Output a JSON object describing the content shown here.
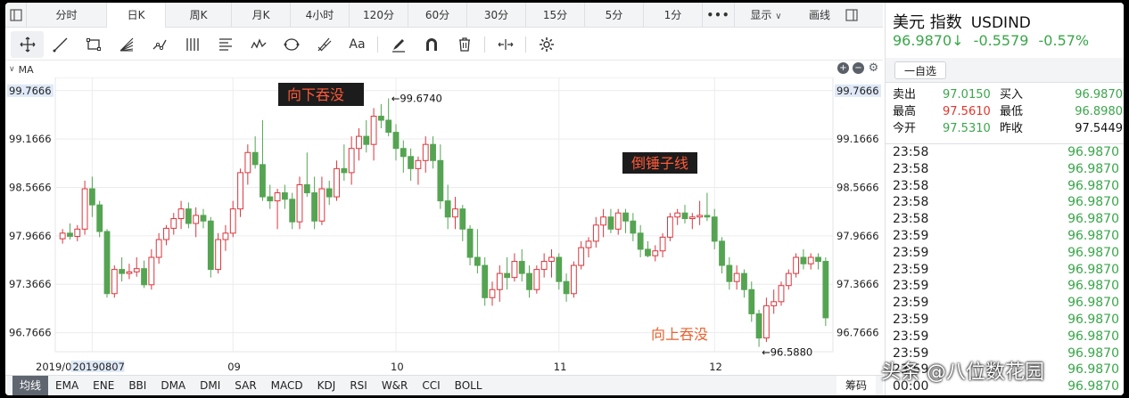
{
  "period_tabs": [
    {
      "label": "分时",
      "w": 90,
      "active": false
    },
    {
      "label": "日K",
      "w": 66,
      "active": true
    },
    {
      "label": "周K",
      "w": 74,
      "active": false
    },
    {
      "label": "月K",
      "w": 66,
      "active": false
    },
    {
      "label": "4小时",
      "w": 66,
      "active": false
    },
    {
      "label": "120分",
      "w": 66,
      "active": false
    },
    {
      "label": "60分",
      "w": 66,
      "active": false
    },
    {
      "label": "30分",
      "w": 66,
      "active": false
    },
    {
      "label": "15分",
      "w": 66,
      "active": false
    },
    {
      "label": "5分",
      "w": 66,
      "active": false
    },
    {
      "label": "1分",
      "w": 66,
      "active": false
    },
    {
      "label": "•••",
      "w": 36,
      "active": false,
      "cls": "more"
    }
  ],
  "display_menu": "显示",
  "draw_menu": "画线",
  "toolbar": {
    "font_tool_label": "Aa",
    "tools": [
      "crosshair-tool",
      "trendline-tool",
      "rectangle-tool",
      "fan-tool",
      "path-tool",
      "parallel-tool",
      "fib-tool",
      "wave-tool",
      "ellipse-tool",
      "gann-tool",
      "text-tool",
      "brush-tool",
      "magnet-tool",
      "delete-tool",
      "measure-tool",
      "settings-tool"
    ]
  },
  "ma_label": "MA",
  "chart": {
    "y_labels": [
      "99.7666",
      "99.1666",
      "98.5666",
      "97.9666",
      "97.3666",
      "96.7666"
    ],
    "y_values": [
      99.7666,
      99.1666,
      98.5666,
      97.9666,
      97.3666,
      96.7666
    ],
    "y_range": [
      96.53,
      99.93
    ],
    "x_labels": [
      {
        "text": "2019/07",
        "index": 0
      },
      {
        "text": "20190807",
        "index": 4,
        "highlight": true
      },
      {
        "text": "09",
        "index": 23
      },
      {
        "text": "10",
        "index": 45
      },
      {
        "text": "11",
        "index": 67
      },
      {
        "text": "12",
        "index": 88
      }
    ],
    "up_color": "#d9363e",
    "down_color": "#54a452",
    "high_label": "←99.6740",
    "low_label": "←96.5880",
    "annotations": [
      {
        "text": "向下吞没",
        "style": "dark",
        "color": "#ff5a3a"
      },
      {
        "text": "倒锤子线",
        "style": "dark",
        "color": "#ff5a3a"
      },
      {
        "text": "向上吞没",
        "style": "plain",
        "color": "#e8622f"
      }
    ]
  },
  "chart_data": {
    "type": "candlestick",
    "ohlc": [
      [
        97.93,
        98.05,
        97.87,
        98.0
      ],
      [
        98.0,
        98.12,
        97.92,
        97.96
      ],
      [
        97.96,
        98.1,
        97.9,
        98.05
      ],
      [
        98.05,
        98.65,
        97.98,
        98.55
      ],
      [
        98.55,
        98.7,
        98.2,
        98.35
      ],
      [
        98.35,
        98.4,
        97.95,
        98.02
      ],
      [
        98.02,
        98.05,
        97.2,
        97.25
      ],
      [
        97.25,
        97.6,
        97.2,
        97.55
      ],
      [
        97.55,
        97.7,
        97.4,
        97.5
      ],
      [
        97.5,
        97.62,
        97.43,
        97.52
      ],
      [
        97.52,
        97.7,
        97.46,
        97.56
      ],
      [
        97.56,
        97.66,
        97.32,
        97.36
      ],
      [
        97.36,
        97.8,
        97.3,
        97.7
      ],
      [
        97.7,
        98.0,
        97.62,
        97.92
      ],
      [
        97.92,
        98.1,
        97.85,
        98.06
      ],
      [
        98.06,
        98.25,
        97.98,
        98.18
      ],
      [
        98.18,
        98.4,
        98.05,
        98.3
      ],
      [
        98.3,
        98.38,
        98.06,
        98.12
      ],
      [
        98.12,
        98.32,
        97.95,
        98.22
      ],
      [
        98.22,
        98.3,
        98.06,
        98.15
      ],
      [
        98.15,
        98.2,
        97.45,
        97.55
      ],
      [
        97.55,
        98.0,
        97.5,
        97.92
      ],
      [
        97.92,
        98.1,
        97.78,
        98.0
      ],
      [
        98.0,
        98.4,
        97.95,
        98.3
      ],
      [
        98.3,
        98.8,
        98.2,
        98.75
      ],
      [
        98.75,
        99.1,
        98.6,
        99.0
      ],
      [
        99.0,
        99.2,
        98.8,
        98.85
      ],
      [
        98.85,
        99.4,
        98.4,
        98.45
      ],
      [
        98.45,
        98.6,
        98.3,
        98.4
      ],
      [
        98.4,
        98.55,
        98.05,
        98.5
      ],
      [
        98.5,
        98.6,
        98.3,
        98.42
      ],
      [
        98.42,
        98.5,
        98.05,
        98.14
      ],
      [
        98.14,
        98.7,
        98.05,
        98.6
      ],
      [
        98.6,
        99.0,
        98.45,
        98.5
      ],
      [
        98.5,
        98.7,
        98.05,
        98.15
      ],
      [
        98.15,
        98.7,
        98.1,
        98.55
      ],
      [
        98.55,
        98.65,
        98.35,
        98.45
      ],
      [
        98.45,
        98.9,
        98.4,
        98.8
      ],
      [
        98.8,
        99.1,
        98.65,
        98.75
      ],
      [
        98.75,
        99.2,
        98.6,
        99.05
      ],
      [
        99.05,
        99.3,
        98.9,
        99.2
      ],
      [
        99.2,
        99.4,
        99.0,
        99.1
      ],
      [
        99.1,
        99.55,
        98.9,
        99.45
      ],
      [
        99.45,
        99.6,
        99.3,
        99.4
      ],
      [
        99.4,
        99.67,
        99.2,
        99.25
      ],
      [
        99.25,
        99.35,
        98.9,
        99.05
      ],
      [
        99.05,
        99.15,
        98.75,
        98.95
      ],
      [
        98.95,
        99.05,
        98.65,
        98.8
      ],
      [
        98.8,
        98.95,
        98.6,
        98.9
      ],
      [
        98.9,
        99.2,
        98.75,
        99.1
      ],
      [
        99.1,
        99.2,
        98.8,
        98.9
      ],
      [
        98.9,
        99.1,
        98.3,
        98.4
      ],
      [
        98.4,
        98.6,
        98.05,
        98.2
      ],
      [
        98.2,
        98.45,
        98.05,
        98.3
      ],
      [
        98.3,
        98.35,
        97.9,
        98.05
      ],
      [
        98.05,
        98.1,
        97.6,
        97.7
      ],
      [
        97.7,
        98.05,
        97.5,
        97.6
      ],
      [
        97.6,
        97.7,
        97.1,
        97.2
      ],
      [
        97.2,
        97.4,
        97.1,
        97.3
      ],
      [
        97.3,
        97.6,
        97.15,
        97.5
      ],
      [
        97.5,
        97.7,
        97.3,
        97.45
      ],
      [
        97.45,
        97.75,
        97.4,
        97.65
      ],
      [
        97.65,
        97.8,
        97.4,
        97.5
      ],
      [
        97.5,
        97.6,
        97.2,
        97.3
      ],
      [
        97.3,
        97.6,
        97.25,
        97.55
      ],
      [
        97.55,
        97.75,
        97.45,
        97.65
      ],
      [
        97.65,
        97.8,
        97.45,
        97.7
      ],
      [
        97.7,
        97.75,
        97.3,
        97.4
      ],
      [
        97.4,
        97.5,
        97.15,
        97.25
      ],
      [
        97.25,
        97.65,
        97.2,
        97.6
      ],
      [
        97.6,
        97.9,
        97.55,
        97.82
      ],
      [
        97.82,
        97.95,
        97.7,
        97.9
      ],
      [
        97.9,
        98.2,
        97.82,
        98.1
      ],
      [
        98.1,
        98.3,
        97.95,
        98.2
      ],
      [
        98.2,
        98.3,
        98.0,
        98.05
      ],
      [
        98.05,
        98.3,
        97.98,
        98.25
      ],
      [
        98.25,
        98.3,
        98.0,
        98.15
      ],
      [
        98.15,
        98.25,
        97.9,
        98.0
      ],
      [
        98.0,
        98.1,
        97.7,
        97.8
      ],
      [
        97.8,
        97.9,
        97.7,
        97.72
      ],
      [
        97.72,
        97.85,
        97.65,
        97.78
      ],
      [
        97.78,
        98.0,
        97.7,
        97.95
      ],
      [
        97.95,
        98.25,
        97.9,
        98.2
      ],
      [
        98.2,
        98.3,
        98.1,
        98.25
      ],
      [
        98.25,
        98.35,
        98.12,
        98.18
      ],
      [
        98.18,
        98.25,
        98.05,
        98.2
      ],
      [
        98.2,
        98.4,
        98.1,
        98.22
      ],
      [
        98.22,
        98.5,
        98.15,
        98.2
      ],
      [
        98.2,
        98.3,
        97.8,
        97.9
      ],
      [
        97.9,
        97.95,
        97.5,
        97.6
      ],
      [
        97.6,
        97.7,
        97.3,
        97.4
      ],
      [
        97.4,
        97.6,
        97.3,
        97.5
      ],
      [
        97.5,
        97.55,
        97.2,
        97.3
      ],
      [
        97.3,
        97.4,
        96.9,
        97.0
      ],
      [
        97.0,
        97.05,
        96.59,
        96.7
      ],
      [
        96.7,
        97.2,
        96.65,
        97.1
      ],
      [
        97.1,
        97.3,
        97.0,
        97.15
      ],
      [
        97.15,
        97.4,
        97.1,
        97.35
      ],
      [
        97.35,
        97.55,
        97.3,
        97.5
      ],
      [
        97.5,
        97.75,
        97.45,
        97.7
      ],
      [
        97.7,
        97.8,
        97.55,
        97.62
      ],
      [
        97.62,
        97.75,
        97.55,
        97.7
      ],
      [
        97.7,
        97.75,
        97.55,
        97.65
      ],
      [
        97.65,
        97.7,
        96.85,
        96.95
      ]
    ]
  },
  "indicator_tabs": [
    "均线",
    "EMA",
    "ENE",
    "BBI",
    "DMA",
    "DMI",
    "SAR",
    "MACD",
    "KDJ",
    "RSI",
    "W&R",
    "CCI",
    "BOLL"
  ],
  "indicator_right": "筹码",
  "quote": {
    "name": "美元 指数",
    "code": "USDIND",
    "price": "96.9870↓",
    "change": "-0.5579",
    "change_pct": "-0.57%",
    "watch_label": "一自选",
    "stats": [
      {
        "l1": "卖出",
        "v1": "97.0150",
        "c1": "g",
        "l2": "买入",
        "v2": "96.9870",
        "c2": "g"
      },
      {
        "l1": "最高",
        "v1": "97.5610",
        "c1": "r",
        "l2": "最低",
        "v2": "96.8980",
        "c2": "g"
      },
      {
        "l1": "今开",
        "v1": "97.5310",
        "c1": "g",
        "l2": "昨收",
        "v2": "97.5449",
        "c2": "k"
      }
    ],
    "ticks": [
      {
        "time": "23:58",
        "value": "96.9870"
      },
      {
        "time": "23:58",
        "value": "96.9870"
      },
      {
        "time": "23:58",
        "value": "96.9870"
      },
      {
        "time": "23:58",
        "value": "96.9870"
      },
      {
        "time": "23:58",
        "value": "96.9870"
      },
      {
        "time": "23:59",
        "value": "96.9870"
      },
      {
        "time": "23:59",
        "value": "96.9870"
      },
      {
        "time": "23:59",
        "value": "96.9870"
      },
      {
        "time": "23:59",
        "value": "96.9870"
      },
      {
        "time": "23:59",
        "value": "96.9870"
      },
      {
        "time": "23:59",
        "value": "96.9870"
      },
      {
        "time": "23:59",
        "value": "96.9870"
      },
      {
        "time": "23:59",
        "value": "96.9870"
      },
      {
        "time": "23:59",
        "value": "96.9870"
      },
      {
        "time": "00:00",
        "value": "96.9870"
      }
    ]
  },
  "watermark": "头条 @八位数花园"
}
